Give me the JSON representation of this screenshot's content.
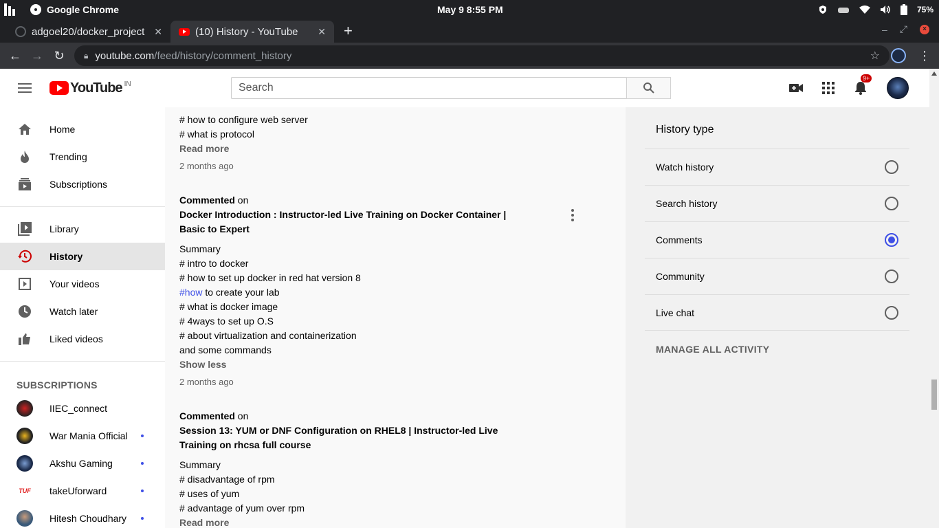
{
  "os": {
    "app_name": "Google Chrome",
    "clock": "May 9   8:55 PM",
    "battery": "75%"
  },
  "tabs": [
    {
      "title": "adgoel20/docker_project",
      "close": "✕"
    },
    {
      "title": "(10) History - YouTube",
      "close": "✕"
    }
  ],
  "newtab_label": "+",
  "address": {
    "host": "youtube.com",
    "path": "/feed/history/comment_history"
  },
  "youtube": {
    "logo_text": "YouTube",
    "country_code": "IN",
    "search_placeholder": "Search",
    "notifications_badge": "9+"
  },
  "sidebar": {
    "main": [
      {
        "label": "Home",
        "icon": "home-icon"
      },
      {
        "label": "Trending",
        "icon": "fire-icon"
      },
      {
        "label": "Subscriptions",
        "icon": "subscriptions-icon"
      }
    ],
    "library": [
      {
        "label": "Library",
        "icon": "library-icon"
      },
      {
        "label": "History",
        "icon": "history-icon",
        "active": true
      },
      {
        "label": "Your videos",
        "icon": "your-videos-icon"
      },
      {
        "label": "Watch later",
        "icon": "clock-icon"
      },
      {
        "label": "Liked videos",
        "icon": "thumbs-up-icon"
      }
    ],
    "subscriptions_header": "SUBSCRIPTIONS",
    "subscriptions": [
      {
        "label": "IIEC_connect"
      },
      {
        "label": "War Mania Official"
      },
      {
        "label": "Akshu Gaming"
      },
      {
        "label": "takeUforward"
      },
      {
        "label": "Hitesh Choudhary"
      }
    ]
  },
  "feed": {
    "first": {
      "lines": [
        "# how to configure web server",
        "# what is protocol"
      ],
      "read_more": "Read more",
      "ago": "2 months ago"
    },
    "second": {
      "commented": "Commented",
      "on": "on",
      "title": "Docker Introduction : Instructor-led Live Training on Docker Container | Basic to Expert",
      "lines": [
        "Summary",
        "# intro to docker",
        "# how to set up docker in red hat version 8"
      ],
      "hash_word": "#how",
      "hash_rest": " to create your lab",
      "lines2": [
        "# what is docker image",
        "# 4ways to set up O.S",
        "# about virtualization and containerization",
        "and some commands"
      ],
      "show_less": "Show less",
      "ago": "2 months ago"
    },
    "third": {
      "commented": "Commented",
      "on": "on",
      "title": "Session 13: YUM or DNF Configuration on RHEL8 | Instructor-led Live Training on rhcsa full course",
      "lines": [
        "Summary",
        "# disadvantage of rpm",
        "# uses of yum",
        "# advantage of yum over rpm"
      ],
      "read_more": "Read more"
    }
  },
  "panel": {
    "title": "History type",
    "options": [
      {
        "label": "Watch history",
        "selected": false
      },
      {
        "label": "Search history",
        "selected": false
      },
      {
        "label": "Comments",
        "selected": true
      },
      {
        "label": "Community",
        "selected": false
      },
      {
        "label": "Live chat",
        "selected": false
      }
    ],
    "manage": "MANAGE ALL ACTIVITY"
  },
  "colors": {
    "accent": "#3e4fe6",
    "youtube_red": "#ff0000"
  }
}
